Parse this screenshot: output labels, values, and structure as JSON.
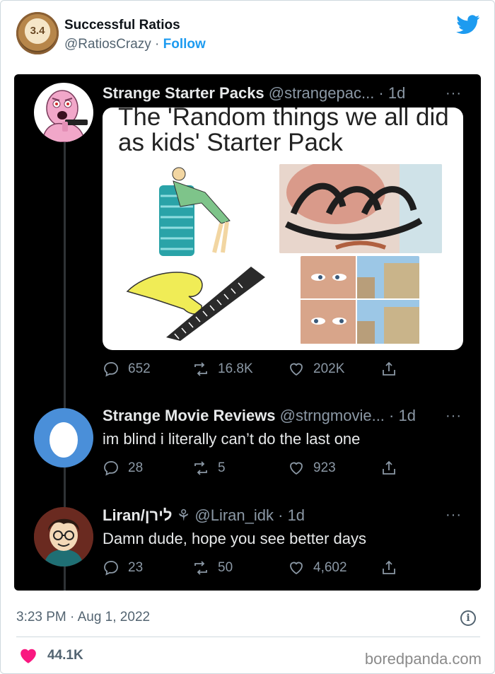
{
  "header": {
    "avatar_text": "3.4",
    "name": "Successful Ratios",
    "handle": "@RatiosCrazy",
    "separator": " · ",
    "follow_label": "Follow"
  },
  "tweets": [
    {
      "name": "Strange Starter Packs",
      "meta": " @strangepac... · 1d",
      "more": "···",
      "image_title": "The 'Random things we all did as kids' Starter Pack",
      "replies": "652",
      "retweets": "16.8K",
      "likes": "202K"
    },
    {
      "name": "Strange Movie Reviews",
      "meta": " @strngmovie... · 1d",
      "more": "···",
      "text": "im blind i literally can’t do the last one",
      "replies": "28",
      "retweets": "5",
      "likes": "923"
    },
    {
      "name": "Liran/לירן",
      "meta": " ⚘ @Liran_idk · 1d",
      "more": "···",
      "text": "Damn dude, hope you see better days",
      "replies": "23",
      "retweets": "50",
      "likes": "4,602"
    }
  ],
  "footer": {
    "timestamp": "3:23 PM · Aug 1, 2022",
    "info_glyph": "i",
    "like_count": "44.1K",
    "brand": "boredpanda.com"
  },
  "colors": {
    "twitter_blue": "#1d9bf0",
    "like_pink": "#f91880",
    "embed_bg": "#000000"
  }
}
